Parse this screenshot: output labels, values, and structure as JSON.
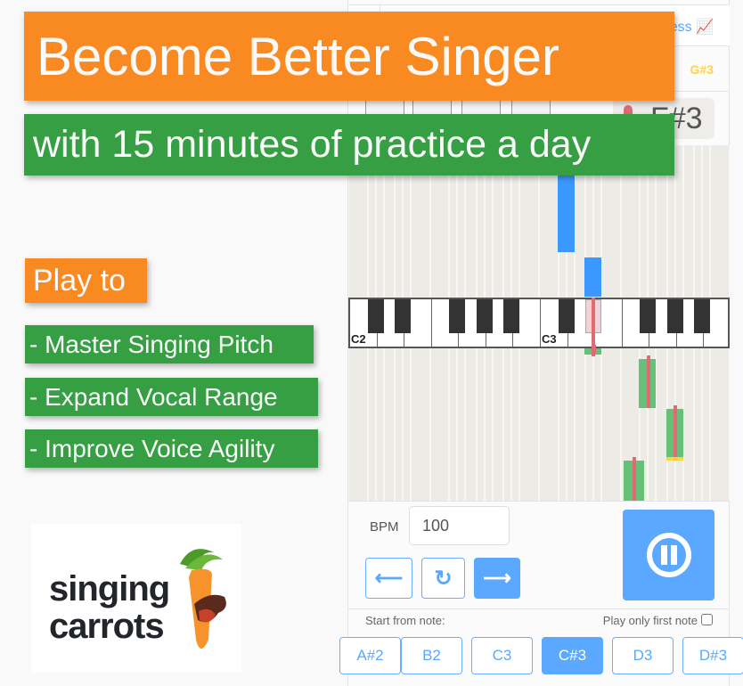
{
  "promo": {
    "headline": "Become Better Singer",
    "subline": "with 15 minutes of practice a day",
    "play_to": "Play to",
    "benefits": [
      "- Master Singing Pitch",
      "- Expand Vocal Range",
      "- Improve Voice Agility"
    ],
    "logo_text": "singing carrots"
  },
  "app": {
    "progress_link": "Progress",
    "target_note": "G#3",
    "current_note": "F#3",
    "keyboard": {
      "labels": [
        "C2",
        "C3"
      ],
      "highlighted_key": "D#3"
    },
    "notes_played": [
      {
        "note": "C#3",
        "status": "upcoming"
      },
      {
        "note": "D#3",
        "status": "upcoming"
      },
      {
        "note": "D#3",
        "status": "current"
      },
      {
        "note": "F#3",
        "status": "sung"
      },
      {
        "note": "G#3",
        "status": "sung"
      },
      {
        "note": "F3",
        "status": "sung"
      }
    ],
    "bpm_label": "BPM",
    "bpm_value": "100",
    "start_from_label": "Start from note:",
    "play_first_label": "Play only first note",
    "play_first_checked": false,
    "start_notes": [
      "A#2",
      "B2",
      "C3",
      "C#3",
      "D3",
      "D#3"
    ],
    "selected_start_note": "C#3",
    "colors": {
      "accent": "#5aa8ff",
      "upcoming": "#3a98ff",
      "sung": "#66c178",
      "pitch": "#e26a73",
      "promo_orange": "#f98a22",
      "promo_green": "#369f43"
    }
  }
}
